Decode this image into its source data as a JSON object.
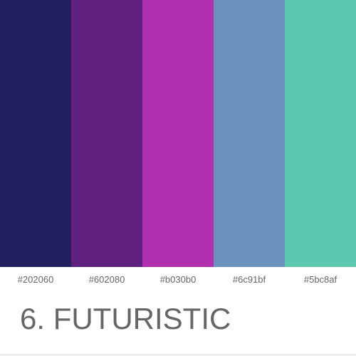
{
  "palette": {
    "title": "6. FUTURISTIC",
    "colors": [
      {
        "hex": "#202060",
        "label": "#202060"
      },
      {
        "hex": "#602080",
        "label": "#602080"
      },
      {
        "hex": "#b030b0",
        "label": "#b030b0"
      },
      {
        "hex": "#6c91bf",
        "label": "#6c91bf"
      },
      {
        "hex": "#5bc8af",
        "label": "#5bc8af"
      }
    ]
  }
}
